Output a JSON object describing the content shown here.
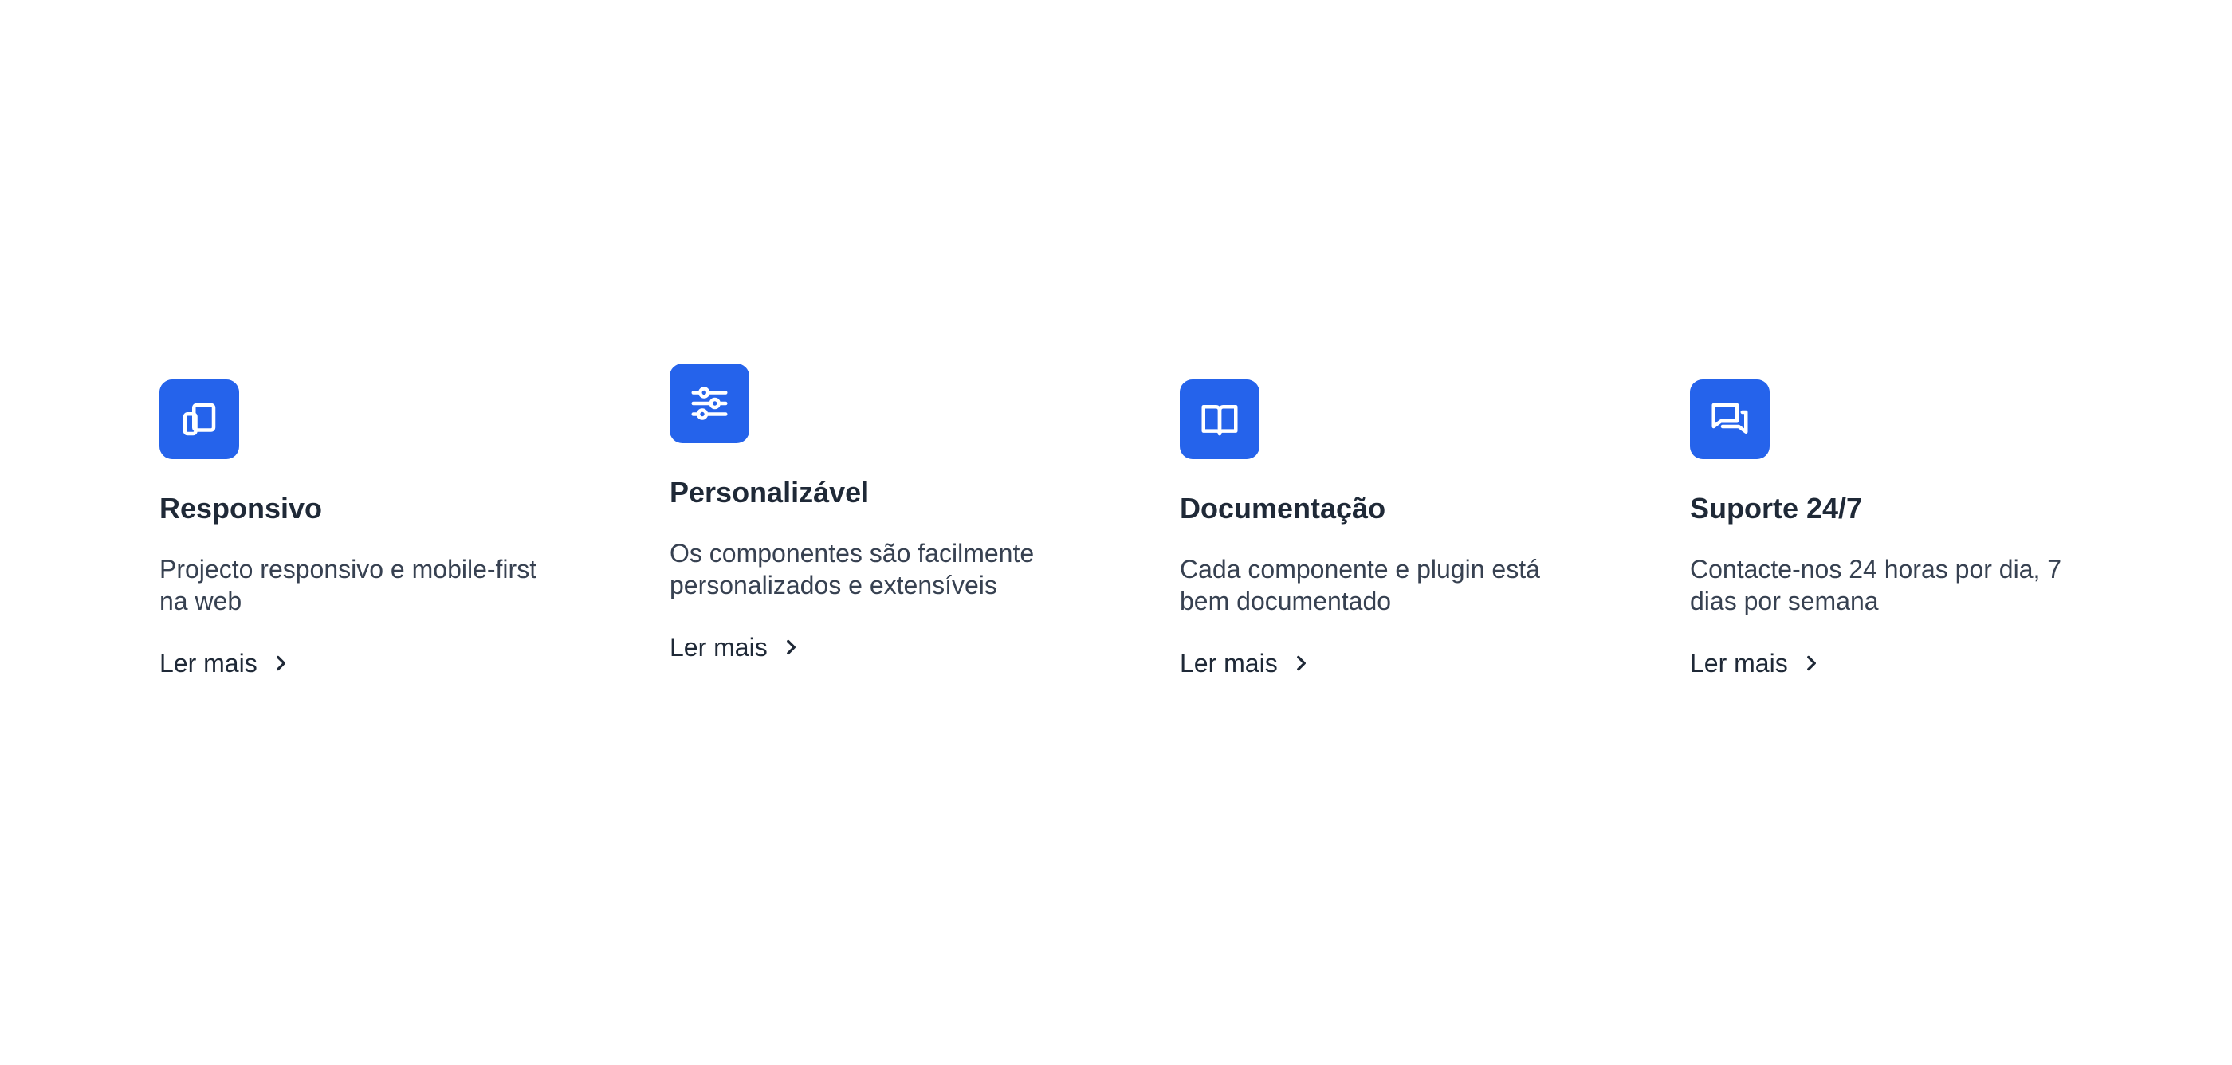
{
  "accent_color": "#2563eb",
  "features": [
    {
      "icon": "devices-icon",
      "title": "Responsivo",
      "description": "Projecto responsivo e mobile-first na web",
      "link_label": "Ler mais"
    },
    {
      "icon": "sliders-icon",
      "title": "Personalizável",
      "description": "Os componentes são facilmente personalizados e extensíveis",
      "link_label": "Ler mais"
    },
    {
      "icon": "book-open-icon",
      "title": "Documentação",
      "description": "Cada componente e plugin está bem documentado",
      "link_label": "Ler mais"
    },
    {
      "icon": "chat-bubbles-icon",
      "title": "Suporte 24/7",
      "description": "Contacte-nos 24 horas por dia, 7 dias por semana",
      "link_label": "Ler mais"
    }
  ]
}
